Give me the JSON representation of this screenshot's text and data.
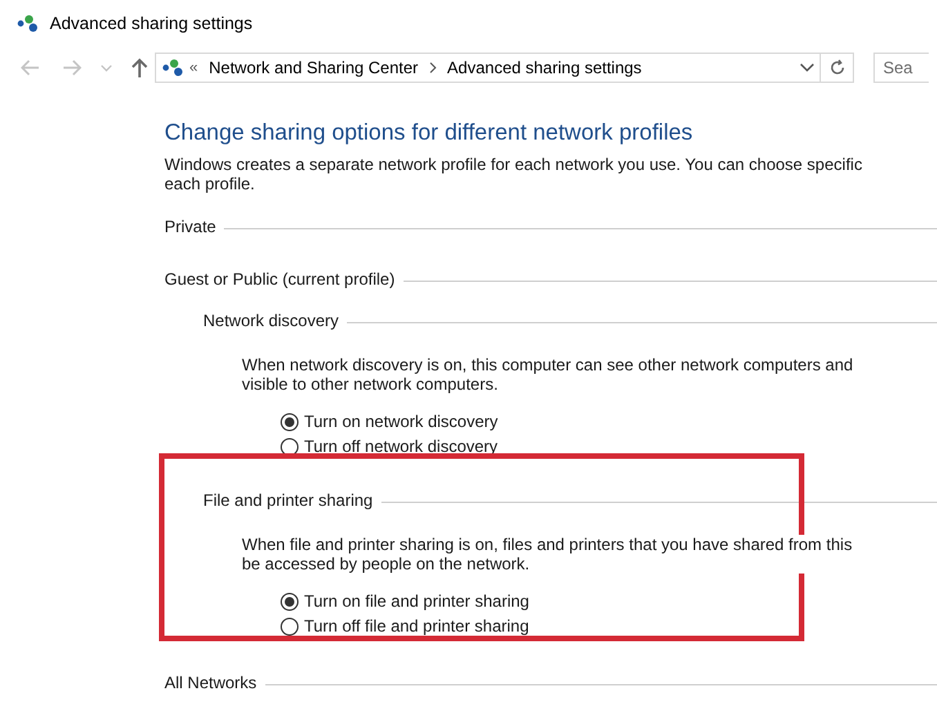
{
  "window": {
    "title": "Advanced sharing settings"
  },
  "address_bar": {
    "overflow": "«",
    "breadcrumbs": [
      "Network and Sharing Center",
      "Advanced sharing settings"
    ]
  },
  "search": {
    "placeholder": "Sea"
  },
  "heading": "Change sharing options for different network profiles",
  "description_lines": [
    "Windows creates a separate network profile for each network you use. You can choose specific",
    "each profile."
  ],
  "profiles": [
    {
      "label": "Private"
    },
    {
      "label": "Guest or Public (current profile)",
      "sections": [
        {
          "label": "Network discovery",
          "description_lines": [
            "When network discovery is on, this computer can see other network computers and",
            "visible to other network computers."
          ],
          "options": [
            {
              "label": "Turn on network discovery",
              "selected": true
            },
            {
              "label": "Turn off network discovery",
              "selected": false
            }
          ]
        },
        {
          "label": "File and printer sharing",
          "highlighted": true,
          "description_lines": [
            "When file and printer sharing is on, files and printers that you have shared from this",
            "be accessed by people on the network."
          ],
          "options": [
            {
              "label": "Turn on file and printer sharing",
              "selected": true
            },
            {
              "label": "Turn off file and printer sharing",
              "selected": false
            }
          ]
        }
      ]
    },
    {
      "label": "All Networks"
    }
  ]
}
